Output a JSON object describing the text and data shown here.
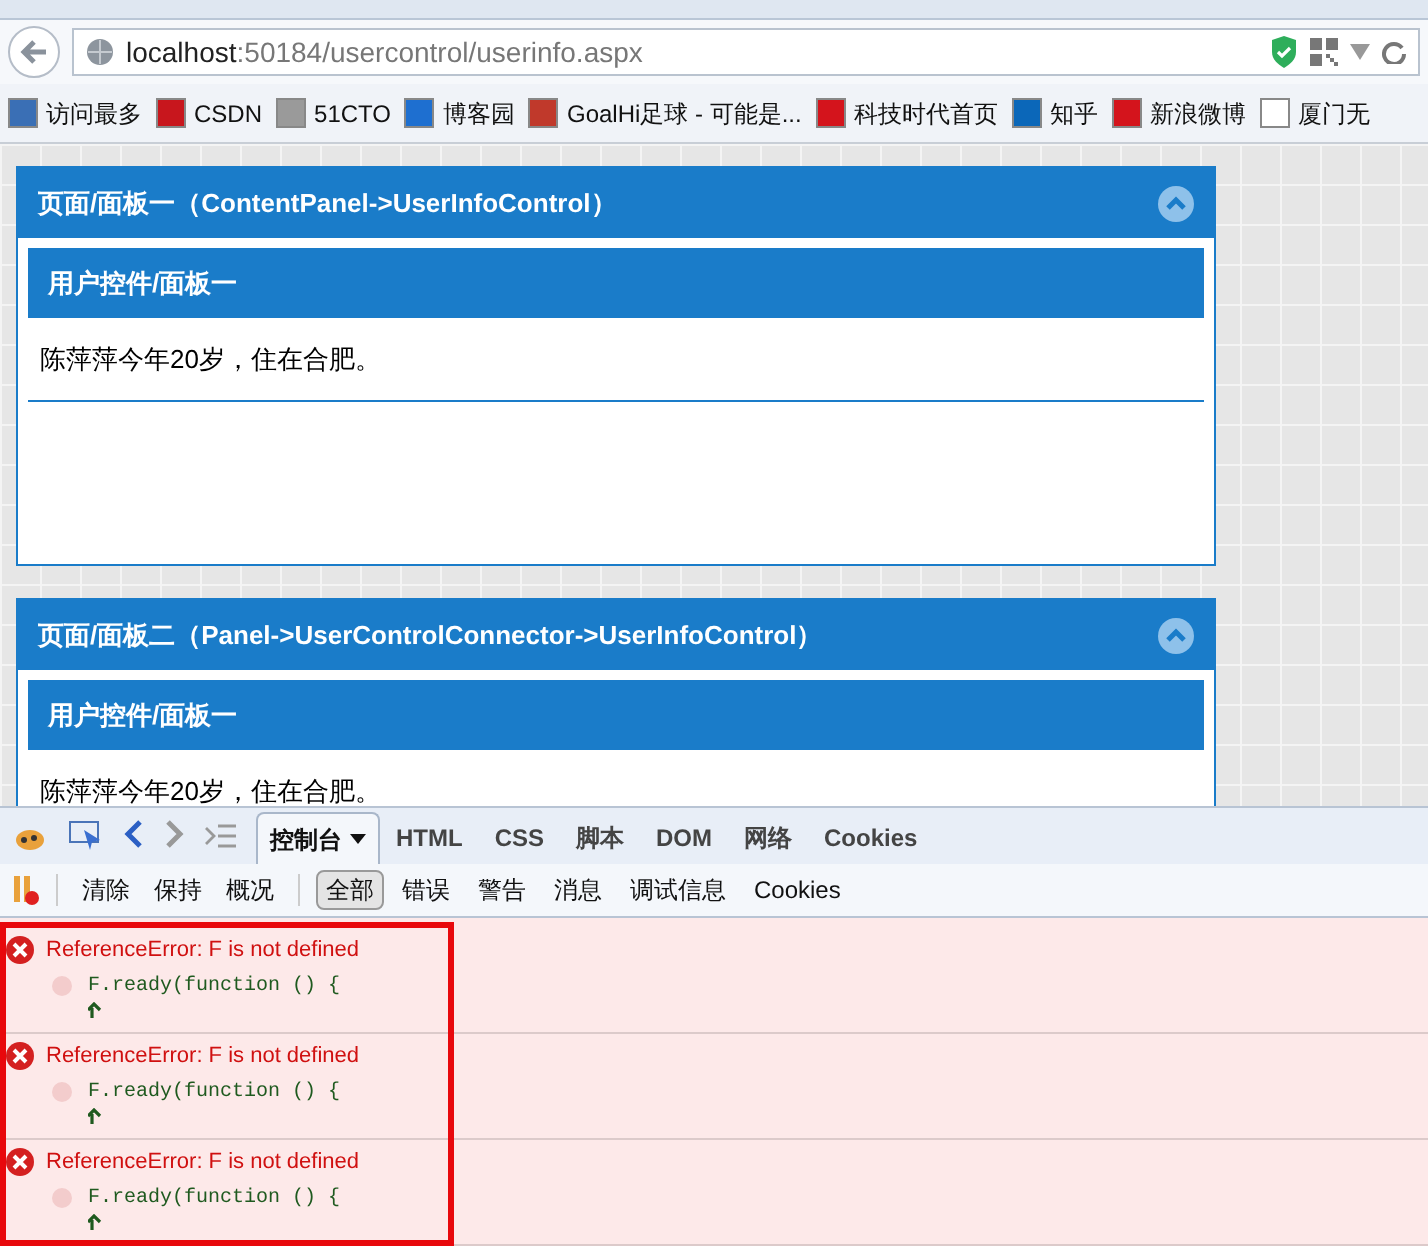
{
  "address_bar": {
    "host": "localhost",
    "path": ":50184/usercontrol/userinfo.aspx"
  },
  "bookmarks": [
    {
      "label": "访问最多",
      "color": "#3a6fb5"
    },
    {
      "label": "CSDN",
      "color": "#c8161d"
    },
    {
      "label": "51CTO",
      "color": "#9a9a9a"
    },
    {
      "label": "博客园",
      "color": "#1e6fd0"
    },
    {
      "label": "GoalHi足球 - 可能是...",
      "color": "#c0392b"
    },
    {
      "label": "科技时代首页",
      "color": "#d4141c"
    },
    {
      "label": "知乎",
      "color": "#0b67b9"
    },
    {
      "label": "新浪微博",
      "color": "#d4141c"
    },
    {
      "label": "厦门无",
      "color": "#ffffff"
    }
  ],
  "panels": [
    {
      "title": "页面/面板一（ContentPanel->UserInfoControl）",
      "inner_title": "用户控件/面板一",
      "text": "陈萍萍今年20岁，住在合肥。",
      "expanded": true
    },
    {
      "title": "页面/面板二（Panel->UserControlConnector->UserInfoControl）",
      "inner_title": "用户控件/面板一",
      "text": "陈萍萍今年20岁，住在合肥。",
      "expanded": true
    }
  ],
  "devtools": {
    "tabs": [
      {
        "label": "控制台",
        "selected": true
      },
      {
        "label": "HTML",
        "selected": false
      },
      {
        "label": "CSS",
        "selected": false
      },
      {
        "label": "脚本",
        "selected": false
      },
      {
        "label": "DOM",
        "selected": false
      },
      {
        "label": "网络",
        "selected": false
      },
      {
        "label": "Cookies",
        "selected": false
      }
    ],
    "actions": [
      "清除",
      "保持",
      "概况"
    ],
    "filters": [
      {
        "label": "全部",
        "selected": true
      },
      {
        "label": "错误",
        "selected": false
      },
      {
        "label": "警告",
        "selected": false
      },
      {
        "label": "消息",
        "selected": false
      },
      {
        "label": "调试信息",
        "selected": false
      },
      {
        "label": "Cookies",
        "selected": false
      }
    ],
    "errors": [
      {
        "message": "ReferenceError: F is not defined",
        "code": "F.ready(function () {"
      },
      {
        "message": "ReferenceError: F is not defined",
        "code": "F.ready(function () {"
      },
      {
        "message": "ReferenceError: F is not defined",
        "code": "F.ready(function () {"
      }
    ]
  }
}
